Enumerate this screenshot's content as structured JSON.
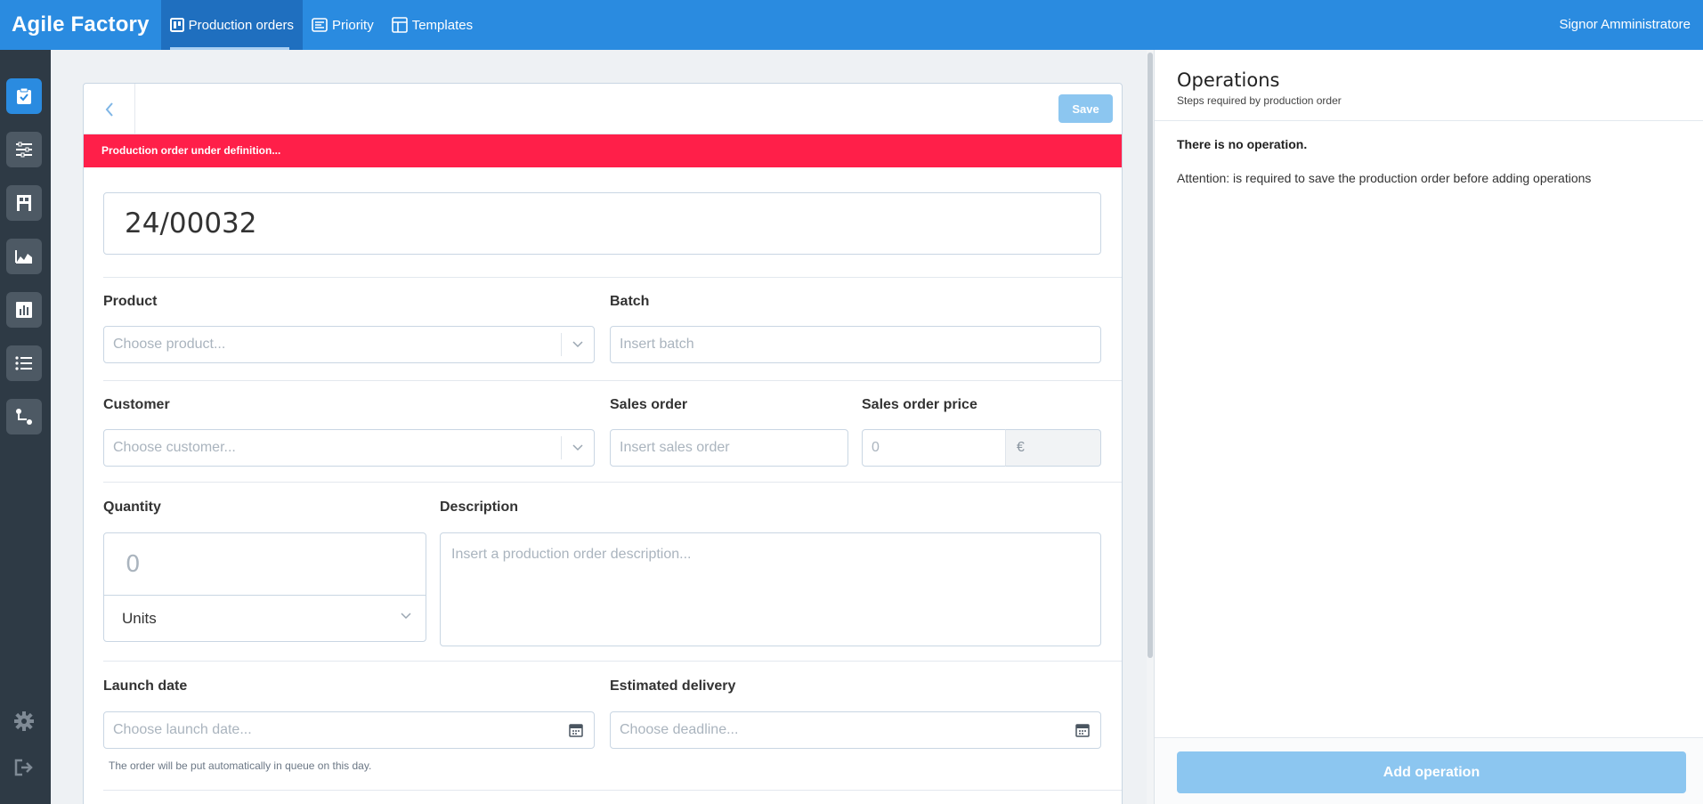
{
  "app": {
    "brand": "Agile Factory",
    "user": "Signor Amministratore"
  },
  "nav": {
    "items": [
      {
        "label": "Production orders",
        "icon": "board-icon",
        "active": true
      },
      {
        "label": "Priority",
        "icon": "priority-icon"
      },
      {
        "label": "Templates",
        "icon": "template-icon"
      }
    ]
  },
  "sidebar": {
    "items": [
      "clipboard-check-icon",
      "sliders-icon",
      "warehouse-icon",
      "area-chart-icon",
      "bar-chart-icon",
      "list-icon",
      "flow-icon"
    ],
    "bottom": [
      "gear-icon",
      "logout-icon"
    ]
  },
  "header": {
    "save_label": "Save"
  },
  "alert": {
    "text": "Production order under definition..."
  },
  "order": {
    "code": "24/00032"
  },
  "form": {
    "product_label": "Product",
    "product_placeholder": "Choose product...",
    "batch_label": "Batch",
    "batch_placeholder": "Insert batch",
    "customer_label": "Customer",
    "customer_placeholder": "Choose customer...",
    "sales_order_label": "Sales order",
    "sales_order_placeholder": "Insert sales order",
    "price_label": "Sales order price",
    "price_value": "0",
    "currency": "€",
    "quantity_label": "Quantity",
    "quantity_value": "0",
    "unit": "Units",
    "description_label": "Description",
    "description_placeholder": "Insert a production order description...",
    "launch_label": "Launch date",
    "launch_placeholder": "Choose launch date...",
    "delivery_label": "Estimated delivery",
    "delivery_placeholder": "Choose deadline...",
    "launch_hint": "The order will be put automatically in queue on this day."
  },
  "operations": {
    "title": "Operations",
    "subtitle": "Steps required by production order",
    "empty": "There is no operation.",
    "note": "Attention: is required to save the production order before adding operations",
    "add_label": "Add operation"
  },
  "colors": {
    "primary": "#2a8be0",
    "alert": "#ff1f49",
    "sidebar": "#2e3a45",
    "disabled_button": "#8cc6f0"
  }
}
